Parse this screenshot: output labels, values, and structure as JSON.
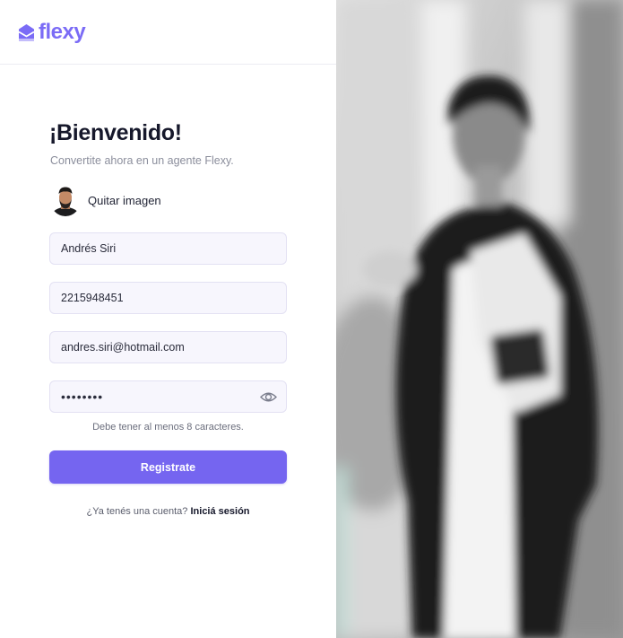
{
  "brand": {
    "name": "flexy",
    "accent_color": "#7565f0",
    "logo_icon": "mailbox-icon"
  },
  "form": {
    "title": "¡Bienvenido!",
    "subtitle": "Convertite ahora en un agente Flexy.",
    "avatar": {
      "icon": "user-avatar",
      "remove_label": "Quitar imagen"
    },
    "fields": {
      "name": {
        "value": "Andrés Siri"
      },
      "phone": {
        "value": "2215948451"
      },
      "email": {
        "value": "andres.siri@hotmail.com"
      },
      "password": {
        "value": "••••••••",
        "toggle_icon": "eye-icon"
      }
    },
    "password_hint": "Debe tener al menos 8 caracteres.",
    "submit_label": "Registrate",
    "login_prompt": "¿Ya tenés una cuenta?",
    "login_link": "Iniciá sesión"
  },
  "hero": {
    "image": "blurred-photo-of-woman-holding-folder"
  }
}
